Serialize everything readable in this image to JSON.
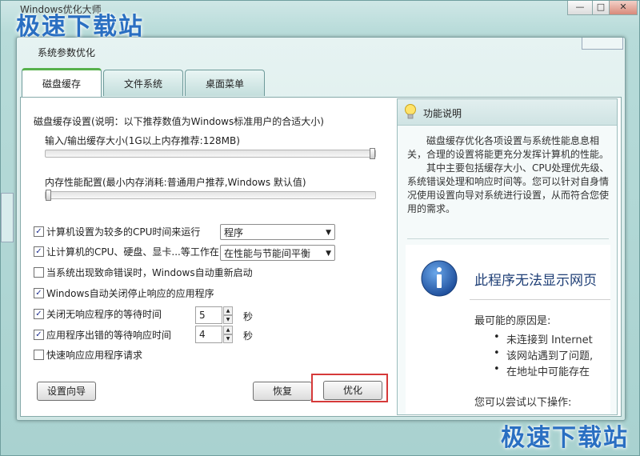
{
  "app": {
    "title": "Windows优化大师",
    "watermark": "极速下载站",
    "controls": {
      "minimize": "—",
      "maximize": "□",
      "close": "✕"
    }
  },
  "dialog": {
    "title": "系统参数优化",
    "tabs": [
      {
        "label": "磁盘缓存",
        "active": true
      },
      {
        "label": "文件系统",
        "active": false
      },
      {
        "label": "桌面菜单",
        "active": false
      }
    ]
  },
  "disk_cache": {
    "section_title": "磁盘缓存设置(说明：以下推荐数值为Windows标准用户的合适大小)",
    "io_buffer_label": "输入/输出缓存大小(1G以上内存推荐:128MB)",
    "io_buffer_level_pct": 100,
    "memory_perf_label": "内存性能配置(最小内存消耗:普通用户推荐,Windows 默认值)",
    "memory_perf_level_pct": 0
  },
  "options": {
    "cpu_time": {
      "label": "计算机设置为较多的CPU时间来运行",
      "checked": true,
      "combo_value": "程序"
    },
    "hw_mode": {
      "label": "让计算机的CPU、硬盘、显卡...等工作在",
      "checked": true,
      "combo_value": "在性能与节能间平衡"
    },
    "auto_restart": {
      "label": "当系统出现致命错误时，Windows自动重新启动",
      "checked": false
    },
    "auto_close": {
      "label": "Windows自动关闭停止响应的应用程序",
      "checked": true
    },
    "close_wait": {
      "label": "关闭无响应程序的等待时间",
      "checked": true,
      "value": "5",
      "unit": "秒"
    },
    "error_wait": {
      "label": "应用程序出错的等待响应时间",
      "checked": true,
      "value": "4",
      "unit": "秒"
    },
    "fast_response": {
      "label": "快速响应应用程序请求",
      "checked": false
    }
  },
  "buttons": {
    "wizard": "设置向导",
    "restore": "恢复",
    "optimize": "优化"
  },
  "info": {
    "title": "功能说明",
    "paragraph1": "磁盘缓存优化各项设置与系统性能息息相关，合理的设置将能更充分发挥计算机的性能。",
    "paragraph2": "其中主要包括缓存大小、CPU处理优先级、系统错误处理和响应时间等。您可以针对自身情况使用设置向导对系统进行设置，从而符合您使用的需求。"
  },
  "web_error": {
    "heading": "此程序无法显示网页",
    "reasons_title": "最可能的原因是:",
    "reasons": [
      "未连接到 Internet",
      "该网站遇到了问题,",
      "在地址中可能存在"
    ],
    "try_text": "您可以尝试以下操作:"
  },
  "colors": {
    "tab_accent": "#57b14c",
    "highlight": "#d63a3a",
    "watermark": "#2a6fc2",
    "info_icon": "#2f66b8"
  }
}
